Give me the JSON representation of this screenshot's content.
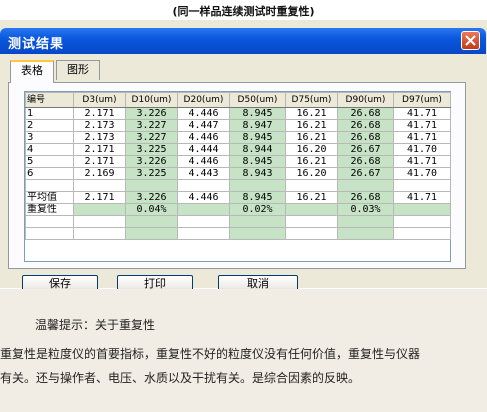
{
  "caption": "(同一样品连续测试时重复性)",
  "window": {
    "title": "测试结果"
  },
  "tabs": [
    {
      "label": "表格",
      "active": true
    },
    {
      "label": "图形",
      "active": false
    }
  ],
  "table": {
    "headers": [
      "编号",
      "D3(um)",
      "D10(um)",
      "D20(um)",
      "D50(um)",
      "D75(um)",
      "D90(um)",
      "D97(um)"
    ],
    "rows": [
      [
        "1",
        "2.171",
        "3.226",
        "4.446",
        "8.945",
        "16.21",
        "26.68",
        "41.71"
      ],
      [
        "2",
        "2.173",
        "3.227",
        "4.447",
        "8.947",
        "16.21",
        "26.68",
        "41.71"
      ],
      [
        "3",
        "2.173",
        "3.227",
        "4.446",
        "8.945",
        "16.21",
        "26.68",
        "41.71"
      ],
      [
        "4",
        "2.171",
        "3.225",
        "4.444",
        "8.944",
        "16.20",
        "26.67",
        "41.70"
      ],
      [
        "5",
        "2.171",
        "3.226",
        "4.446",
        "8.945",
        "16.21",
        "26.68",
        "41.71"
      ],
      [
        "6",
        "2.169",
        "3.225",
        "4.443",
        "8.943",
        "16.20",
        "26.67",
        "41.70"
      ]
    ],
    "average": {
      "label": "平均值",
      "values": [
        "2.171",
        "3.226",
        "4.446",
        "8.945",
        "16.21",
        "26.68",
        "41.71"
      ]
    },
    "repeatability": {
      "label": "重复性",
      "values": [
        "",
        "0.04%",
        "",
        "0.02%",
        "",
        "0.03%",
        ""
      ]
    },
    "highlight_color": "#C6E3C6"
  },
  "buttons": {
    "save": "保存",
    "print": "打印",
    "cancel": "取消"
  },
  "tip": {
    "title": "温馨提示：关于重复性",
    "line1": "重复性是粒度仪的首要指标，重复性不好的粒度仪没有任何价值，重复性与仪器",
    "line2": "有关。还与操作者、电压、水质以及干扰有关。是综合因素的反映。"
  },
  "icons": {
    "close": "close-icon"
  },
  "colors": {
    "titlebar": "#0A58DE",
    "dialog": "#ECE9D8",
    "close": "#C23B16"
  }
}
